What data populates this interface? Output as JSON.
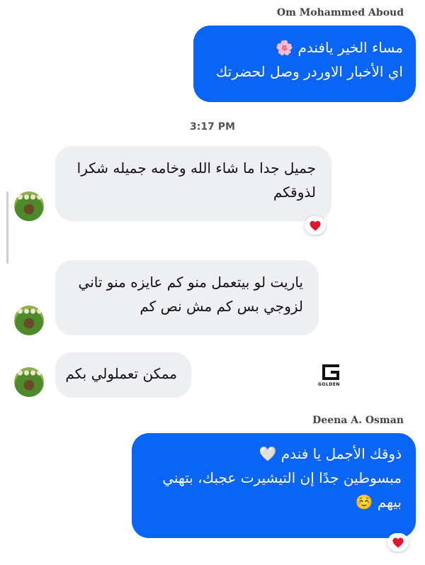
{
  "messages": {
    "sender_1": "Om Mohammed Aboud",
    "msg_1_line1": "مساء الخير يافندم 🌸",
    "msg_1_line2": "اي الأخبار الاوردر وصل لحضرتك",
    "timestamp": "3:17 PM",
    "msg_2_line1": "جميل جدا ما شاء الله وخامه جميله شكرا",
    "msg_2_line2": "لذوقكم",
    "msg_3_line1": "ياريت لو بيتعمل منو كم عايزه منو تاني",
    "msg_3_line2": "لزوجي بس كم مش نص كم",
    "msg_4": "ممكن تعملولي بكم",
    "sender_2": "Deena A. Osman",
    "msg_5_line1": "ذوقك الأجمل يا فندم 🤍",
    "msg_5_line2": "مبسوطين جدًا إن التيشيرت عجبك، بتهني",
    "msg_5_line3": "بيهم ☺️"
  },
  "watermark": {
    "logo_text": "GOLDEN"
  },
  "reactions": {
    "heart_icon": "❤"
  },
  "colors": {
    "outgoing": "#0a64f5",
    "incoming": "#eeeff3",
    "heart": "#e0172e"
  }
}
